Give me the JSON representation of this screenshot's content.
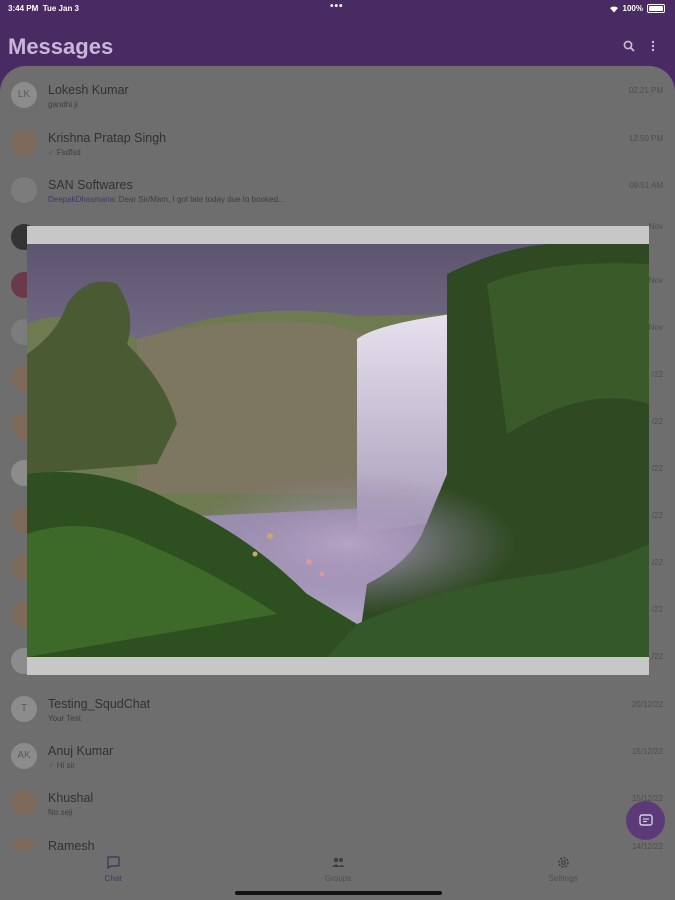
{
  "status_bar": {
    "time": "3:44 PM",
    "date": "Tue Jan 3",
    "dots": "•••",
    "battery": "100%"
  },
  "header": {
    "title": "Messages",
    "search_icon": "search-icon",
    "more_icon": "more-vertical-icon"
  },
  "conversations": [
    {
      "initials": "LK",
      "name": "Lokesh Kumar",
      "preview": "gandhi ji",
      "date": "02:21 PM"
    },
    {
      "initials": "",
      "name": "Krishna Pratap Singh",
      "tick": "✓",
      "preview": "Fsdfsd",
      "date": "12:50 PM"
    },
    {
      "initials": "",
      "name": "SAN Softwares",
      "sender": "DeepakDhasmana:",
      "preview": " Dear Sir/Mam, I got late today due to booked...",
      "date": "09:51 AM"
    },
    {
      "initials": "T",
      "name": "Testing_SqudChat",
      "preview": "Your Test",
      "date": "20/12/22"
    },
    {
      "initials": "AK",
      "name": "Anuj Kumar",
      "tick": "✓",
      "preview": "Hi sir",
      "date": "15/12/22"
    },
    {
      "initials": "",
      "name": "Khushal",
      "preview": "No seji",
      "date": "15/12/22"
    },
    {
      "initials": "",
      "name": "Ramesh",
      "preview": "",
      "date": "14/12/22"
    }
  ],
  "partial_dates": [
    "Nov",
    "Nov",
    "Nov",
    "/22",
    "/22",
    "/22",
    "/22",
    "/22",
    "/22",
    "/22"
  ],
  "bottom_nav": [
    {
      "label": "Chat",
      "icon": "chat-icon"
    },
    {
      "label": "Groups",
      "icon": "groups-icon"
    },
    {
      "label": "Settings",
      "icon": "settings-icon"
    }
  ],
  "fab_icon": "new-message-icon",
  "viewer": {
    "image": "waterfall-photo"
  }
}
